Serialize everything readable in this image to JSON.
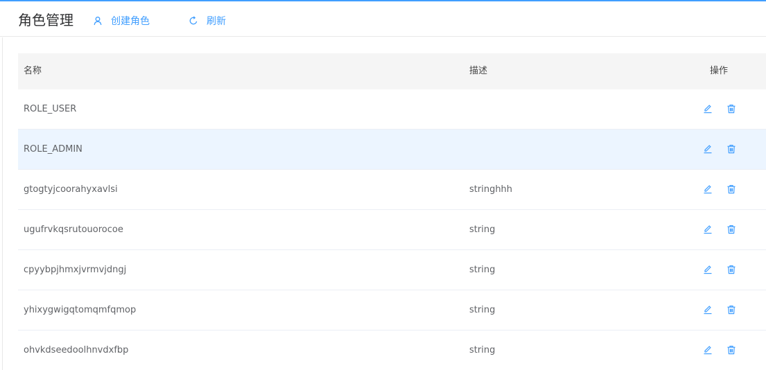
{
  "header": {
    "title": "角色管理",
    "create_label": "创建角色",
    "refresh_label": "刷新"
  },
  "table": {
    "columns": [
      "名称",
      "描述",
      "操作"
    ],
    "rows": [
      {
        "name": "ROLE_USER",
        "description": ""
      },
      {
        "name": "ROLE_ADMIN",
        "description": ""
      },
      {
        "name": "gtogtyjcoorahyxavlsi",
        "description": "stringhhh"
      },
      {
        "name": "ugufrvkqsrutouorocoe",
        "description": "string"
      },
      {
        "name": "cpyybpjhmxjvrmvjdngj",
        "description": "string"
      },
      {
        "name": "yhixygwigqtomqmfqmop",
        "description": "string"
      },
      {
        "name": "ohvkdseedoolhnvdxfbp",
        "description": "string"
      }
    ]
  },
  "colors": {
    "accent": "#409eff",
    "header_bg": "#f5f5f5",
    "row_hover": "#ecf5ff"
  },
  "icons": {
    "create": "user-icon",
    "refresh": "refresh-icon",
    "edit": "edit-icon",
    "delete": "trash-icon"
  }
}
